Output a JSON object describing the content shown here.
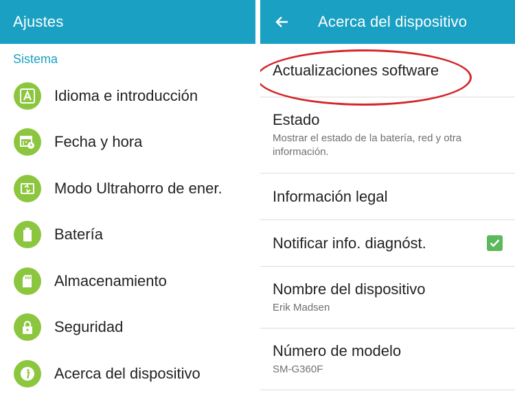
{
  "left": {
    "title": "Ajustes",
    "section": "Sistema",
    "items": [
      {
        "label": "Idioma e introducción",
        "icon": "language-icon"
      },
      {
        "label": "Fecha y hora",
        "icon": "calendar-clock-icon"
      },
      {
        "label": "Modo Ultrahorro de ener.",
        "icon": "power-saving-icon"
      },
      {
        "label": "Batería",
        "icon": "battery-icon"
      },
      {
        "label": "Almacenamiento",
        "icon": "sd-card-icon"
      },
      {
        "label": "Seguridad",
        "icon": "lock-icon"
      },
      {
        "label": "Acerca del dispositivo",
        "icon": "info-icon"
      }
    ]
  },
  "right": {
    "title": "Acerca del dispositivo",
    "items": [
      {
        "title": "Actualizaciones software"
      },
      {
        "title": "Estado",
        "subtitle": "Mostrar el estado de la batería, red y otra información."
      },
      {
        "title": "Información legal"
      },
      {
        "title": "Notificar info. diagnóst.",
        "checked": true
      },
      {
        "title": "Nombre del dispositivo",
        "subtitle": "Erik Madsen"
      },
      {
        "title": "Número de modelo",
        "subtitle": "SM-G360F"
      }
    ]
  },
  "colors": {
    "appbar": "#1aa0c2",
    "section": "#1aa0c2",
    "icon_bg": "#8cc63f",
    "checkbox": "#5cb85c",
    "highlight": "#d4252a"
  }
}
